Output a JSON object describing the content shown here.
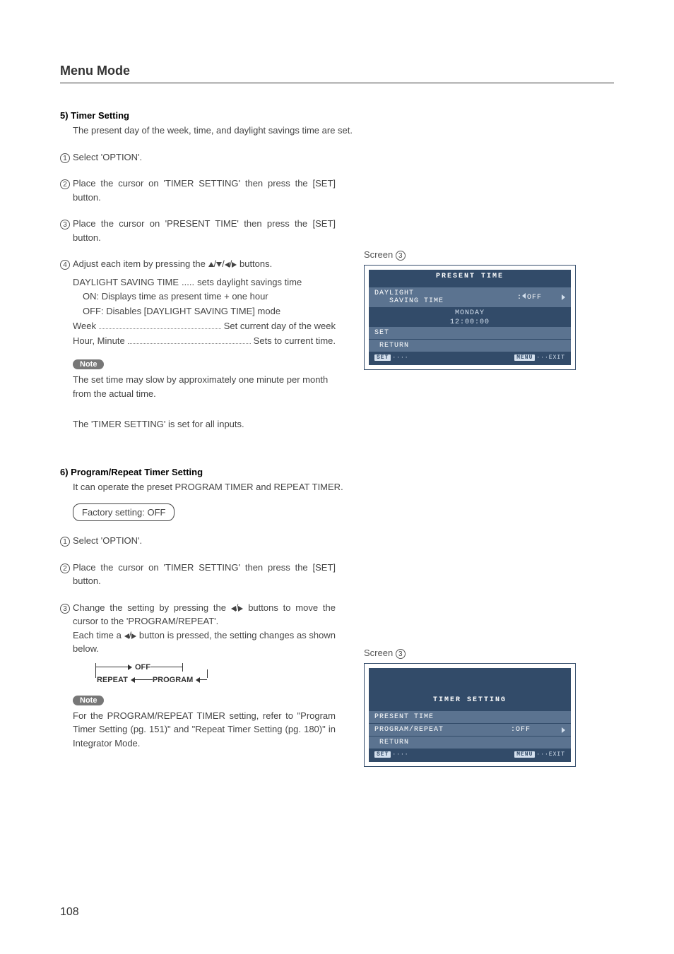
{
  "heading": "Menu Mode",
  "page_number": "108",
  "section5": {
    "title": "5) Timer Setting",
    "intro": "The present day of the week, time, and daylight savings time are set.",
    "steps": {
      "s1": "Select 'OPTION'.",
      "s2": "Place the cursor on 'TIMER SETTING' then press the [SET] button.",
      "s3": "Place the cursor on 'PRESENT TIME' then press the [SET] button.",
      "s4_pre": "Adjust each item by pressing the ",
      "s4_post": " buttons."
    },
    "dst_label": "DAYLIGHT SAVING TIME",
    "dst_desc": "sets daylight savings time",
    "dst_on": "ON: Displays time as present time + one hour",
    "dst_off": "OFF: Disables [DAYLIGHT SAVING TIME] mode",
    "week_label": "Week",
    "week_desc": "Set current day of the week",
    "hm_label": "Hour, Minute",
    "hm_desc": "Sets to current time.",
    "note_label": "Note",
    "note_text": "The set time may slow by approximately one minute per month from the actual time.",
    "footer_line": "The 'TIMER SETTING' is set for all inputs.",
    "screen_label": "Screen ",
    "osd": {
      "title": "PRESENT TIME",
      "daylight": "DAYLIGHT",
      "saving": "SAVING TIME",
      "off": "OFF",
      "day": "MONDAY",
      "time": "12:00:00",
      "set": "SET",
      "return": "RETURN",
      "set_btn": "SET",
      "menu_btn": "MENU",
      "exit": "EXIT"
    }
  },
  "section6": {
    "title": "6) Program/Repeat Timer Setting",
    "intro": "It can operate the preset PROGRAM TIMER and REPEAT TIMER.",
    "factory": "Factory setting: OFF",
    "steps": {
      "s1": "Select 'OPTION'.",
      "s2": "Place the cursor on 'TIMER SETTING' then press the [SET] button.",
      "s3_pre": "Change the setting by pressing the ",
      "s3_mid": " buttons to move the cursor to the 'PROGRAM/REPEAT'.",
      "s3_line2_pre": "Each time a ",
      "s3_line2_post": " button is pressed, the setting changes as shown below."
    },
    "flow": {
      "off": "OFF",
      "repeat": "REPEAT",
      "program": "PROGRAM"
    },
    "note_label": "Note",
    "note_text": "For the PROGRAM/REPEAT TIMER setting, refer to \"Program Timer Setting (pg. 151)\" and \"Repeat Timer Setting (pg. 180)\" in Integrator Mode.",
    "screen_label": "Screen ",
    "osd": {
      "title": "TIMER SETTING",
      "present": "PRESENT TIME",
      "program": "PROGRAM/REPEAT",
      "off": ":OFF",
      "return": "RETURN",
      "set_btn": "SET",
      "menu_btn": "MENU",
      "exit": "EXIT"
    }
  }
}
